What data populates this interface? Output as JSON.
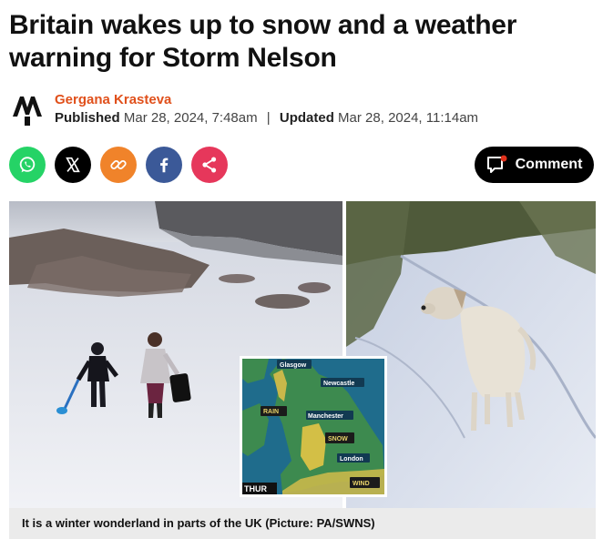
{
  "article": {
    "headline": "Britain wakes up to snow and a weather warning for Storm Nelson",
    "author": "Gergana Krasteva",
    "published_label": "Published",
    "published_date": "Mar 28, 2024, 7:48am",
    "separator": "|",
    "updated_label": "Updated",
    "updated_date": "Mar 28, 2024, 11:14am"
  },
  "share": {
    "buttons": [
      {
        "name": "whatsapp",
        "color": "#25d366"
      },
      {
        "name": "x",
        "color": "#000000"
      },
      {
        "name": "copy-link",
        "color": "#f0832a"
      },
      {
        "name": "facebook",
        "color": "#3b5998"
      },
      {
        "name": "share",
        "color": "#e6375b"
      }
    ],
    "comment_label": "Comment"
  },
  "figure": {
    "map_labels": {
      "glasgow": "Glasgow",
      "newcastle": "Newcastle",
      "rain": "RAIN",
      "manchester": "Manchester",
      "snow": "SNOW",
      "london": "London",
      "wind": "WIND",
      "thur": "THUR"
    },
    "caption": "It is a winter wonderland in parts of the UK (Picture: PA/SWNS)"
  },
  "colors": {
    "author": "#e0501b",
    "caption_bg": "#ebebeb"
  }
}
